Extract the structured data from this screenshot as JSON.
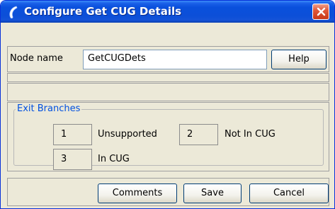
{
  "window": {
    "title": "Configure Get CUG Details"
  },
  "node": {
    "label": "Node name",
    "value": "GetCUGDets",
    "help_label": "Help"
  },
  "exit_branches": {
    "legend": "Exit Branches",
    "items": [
      {
        "number": "1",
        "label": "Unsupported"
      },
      {
        "number": "2",
        "label": "Not In CUG"
      },
      {
        "number": "3",
        "label": "In CUG"
      }
    ]
  },
  "buttons": {
    "comments": "Comments",
    "save": "Save",
    "cancel": "Cancel"
  },
  "colors": {
    "titlebar": "#0c4fd8",
    "legend_text": "#0050e0",
    "close_button": "#e0583a",
    "dialog_bg": "#ece9d8"
  }
}
